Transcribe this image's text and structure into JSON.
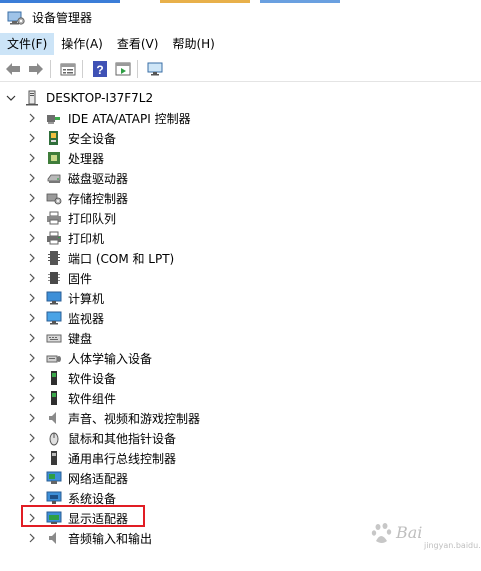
{
  "window": {
    "title": "设备管理器"
  },
  "menu": [
    {
      "label": "文件(F)",
      "active": true
    },
    {
      "label": "操作(A)",
      "active": false
    },
    {
      "label": "查看(V)",
      "active": false
    },
    {
      "label": "帮助(H)",
      "active": false
    }
  ],
  "toolbar": [
    "back-arrow-icon",
    "forward-arrow-icon",
    "properties-icon",
    "help-icon",
    "run-icon",
    "monitor-scan-icon"
  ],
  "tree": {
    "root": "DESKTOP-I37F7L2",
    "items": [
      {
        "label": "IDE ATA/ATAPI 控制器",
        "icon": "ide-controller-icon"
      },
      {
        "label": "安全设备",
        "icon": "security-device-icon"
      },
      {
        "label": "处理器",
        "icon": "processor-icon"
      },
      {
        "label": "磁盘驱动器",
        "icon": "disk-drive-icon"
      },
      {
        "label": "存储控制器",
        "icon": "storage-controller-icon"
      },
      {
        "label": "打印队列",
        "icon": "print-queue-icon"
      },
      {
        "label": "打印机",
        "icon": "printer-icon"
      },
      {
        "label": "端口 (COM 和 LPT)",
        "icon": "port-icon"
      },
      {
        "label": "固件",
        "icon": "firmware-icon"
      },
      {
        "label": "计算机",
        "icon": "computer-icon"
      },
      {
        "label": "监视器",
        "icon": "monitor-icon"
      },
      {
        "label": "键盘",
        "icon": "keyboard-icon"
      },
      {
        "label": "人体学输入设备",
        "icon": "hid-icon"
      },
      {
        "label": "软件设备",
        "icon": "software-device-icon"
      },
      {
        "label": "软件组件",
        "icon": "software-component-icon"
      },
      {
        "label": "声音、视频和游戏控制器",
        "icon": "sound-icon"
      },
      {
        "label": "鼠标和其他指针设备",
        "icon": "mouse-icon"
      },
      {
        "label": "通用串行总线控制器",
        "icon": "usb-icon"
      },
      {
        "label": "网络适配器",
        "icon": "network-adapter-icon"
      },
      {
        "label": "系统设备",
        "icon": "system-device-icon"
      },
      {
        "label": "显示适配器",
        "icon": "display-adapter-icon"
      },
      {
        "label": "音频输入和输出",
        "icon": "audio-io-icon"
      }
    ]
  },
  "watermark": {
    "text": "Bai",
    "sub": "jingyan.baidu.com"
  }
}
